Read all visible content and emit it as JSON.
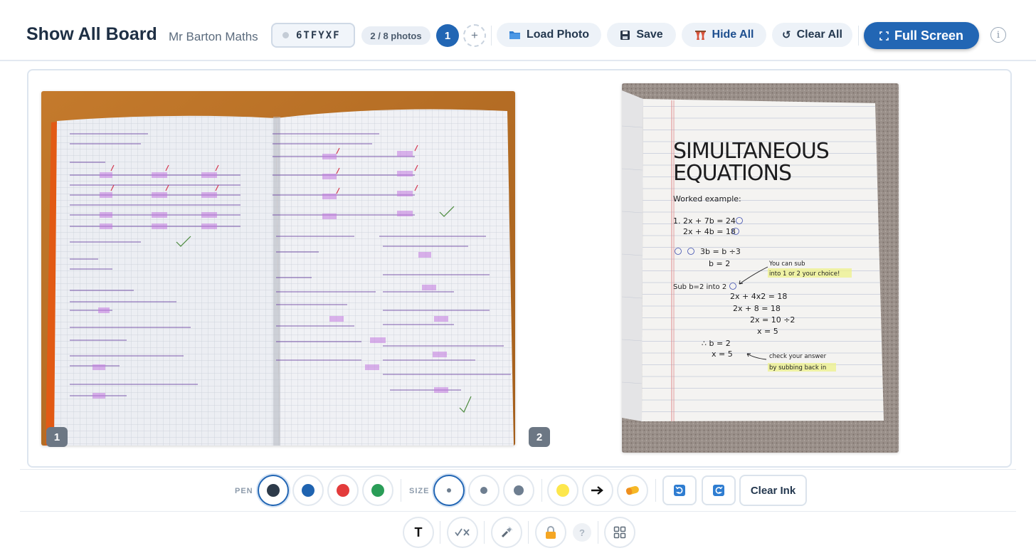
{
  "header": {
    "title": "Show All Board",
    "subtitle": "Mr Barton Maths",
    "session_code": "6TFYXF",
    "photos_count": "2 / 8 photos",
    "current_page": "1",
    "add_page": "+",
    "buttons": {
      "load_photo": "Load Photo",
      "save": "Save",
      "hide_all": "Hide All",
      "clear_all": "Clear All",
      "full_screen": "Full Screen"
    },
    "info": "i"
  },
  "board": {
    "photos": [
      {
        "badge": "1",
        "alt": "Exercise book page with percentage working"
      },
      {
        "badge": "2",
        "alt": "Notebook page with simultaneous equations"
      }
    ],
    "photo2": {
      "heading1": "SIMULTANEOUS",
      "heading2": "EQUATIONS",
      "worked": "Worked example:",
      "eq1": "1. 2x + 7b = 24",
      "eq2": "2x + 4b = 18",
      "step1": "3b = b ÷3",
      "step2": "b = 2",
      "note1a": "You can sub",
      "note1b": "into 1 or 2 your choice!",
      "sub": "Sub b=2 into 2",
      "w1": "2x + 4x2 = 18",
      "w2": "2x + 8 = 18",
      "w3": "2x = 10 ÷2",
      "w4": "x = 5",
      "ans1": "∴ b = 2",
      "ans2": "x = 5",
      "note2a": "check your answer",
      "note2b": "by subbing back in"
    }
  },
  "toolbar": {
    "pen_label": "PEN",
    "size_label": "SIZE",
    "pen_colors": [
      "#2d3a4a",
      "#1f63b0",
      "#e33b3b",
      "#2a9d57"
    ],
    "highlighter_color": "#fde74c",
    "clear_ink": "Clear Ink",
    "text_tool": "T",
    "help": "?"
  },
  "colors": {
    "accent": "#2266b4",
    "pill_bg": "#edf2f8",
    "badge_bg": "#6c7784"
  }
}
